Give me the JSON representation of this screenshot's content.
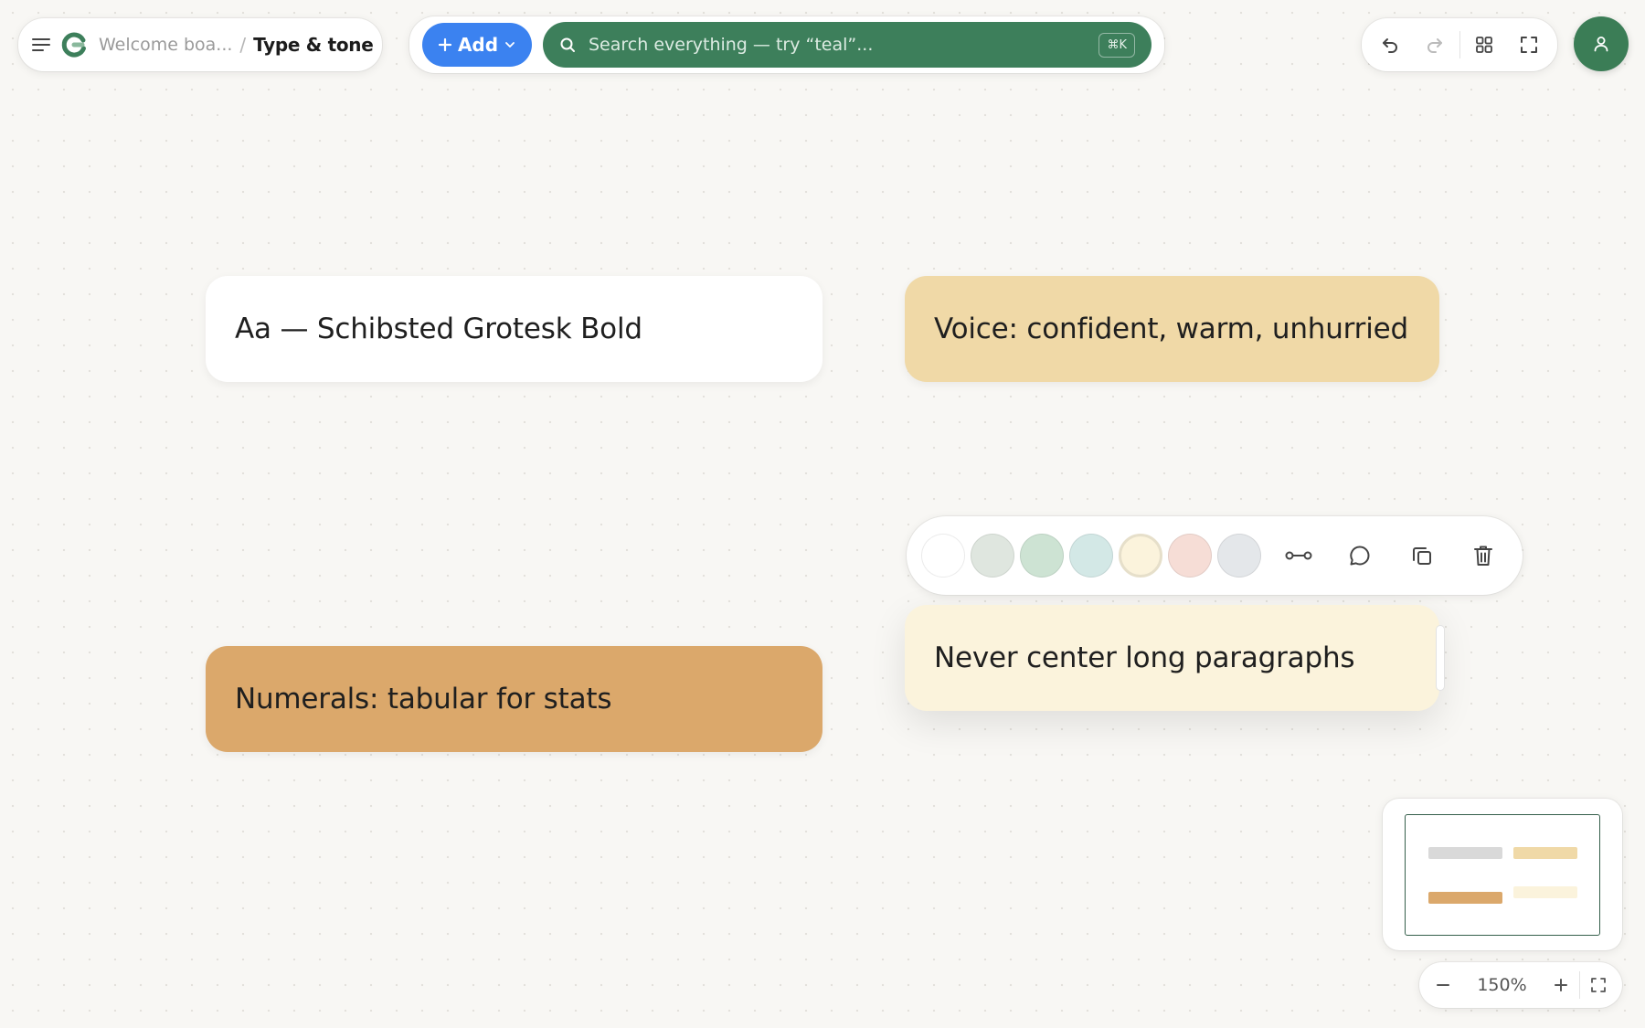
{
  "breadcrumb": {
    "parent": "Welcome boa...",
    "separator": "/",
    "current": "Type & tone"
  },
  "toolbar": {
    "add_label": "Add",
    "search_placeholder": "Search everything — try “teal”...",
    "search_shortcut": "⌘K"
  },
  "cards": [
    {
      "text": "Aa — Schibsted Grotesk Bold",
      "color": "#ffffff"
    },
    {
      "text": "Voice: confident, warm, unhurried",
      "color": "#f0d9a7"
    },
    {
      "text": "Numerals: tabular for stats",
      "color": "#dba86b"
    },
    {
      "text": "Never center long paragraphs",
      "color": "#fbf3dc"
    }
  ],
  "color_swatches": [
    "#ffffff",
    "#dfe6df",
    "#cde3d3",
    "#d3e8e6",
    "#fbf3dc",
    "#f6ddd6",
    "#e4e7ea"
  ],
  "selected_swatch": "#fbf3dc",
  "accent_colors": {
    "add_button": "#3b82f0",
    "search_bar": "#3d7f5b",
    "avatar": "#3b7d56"
  },
  "zoom": {
    "level": "150%"
  }
}
